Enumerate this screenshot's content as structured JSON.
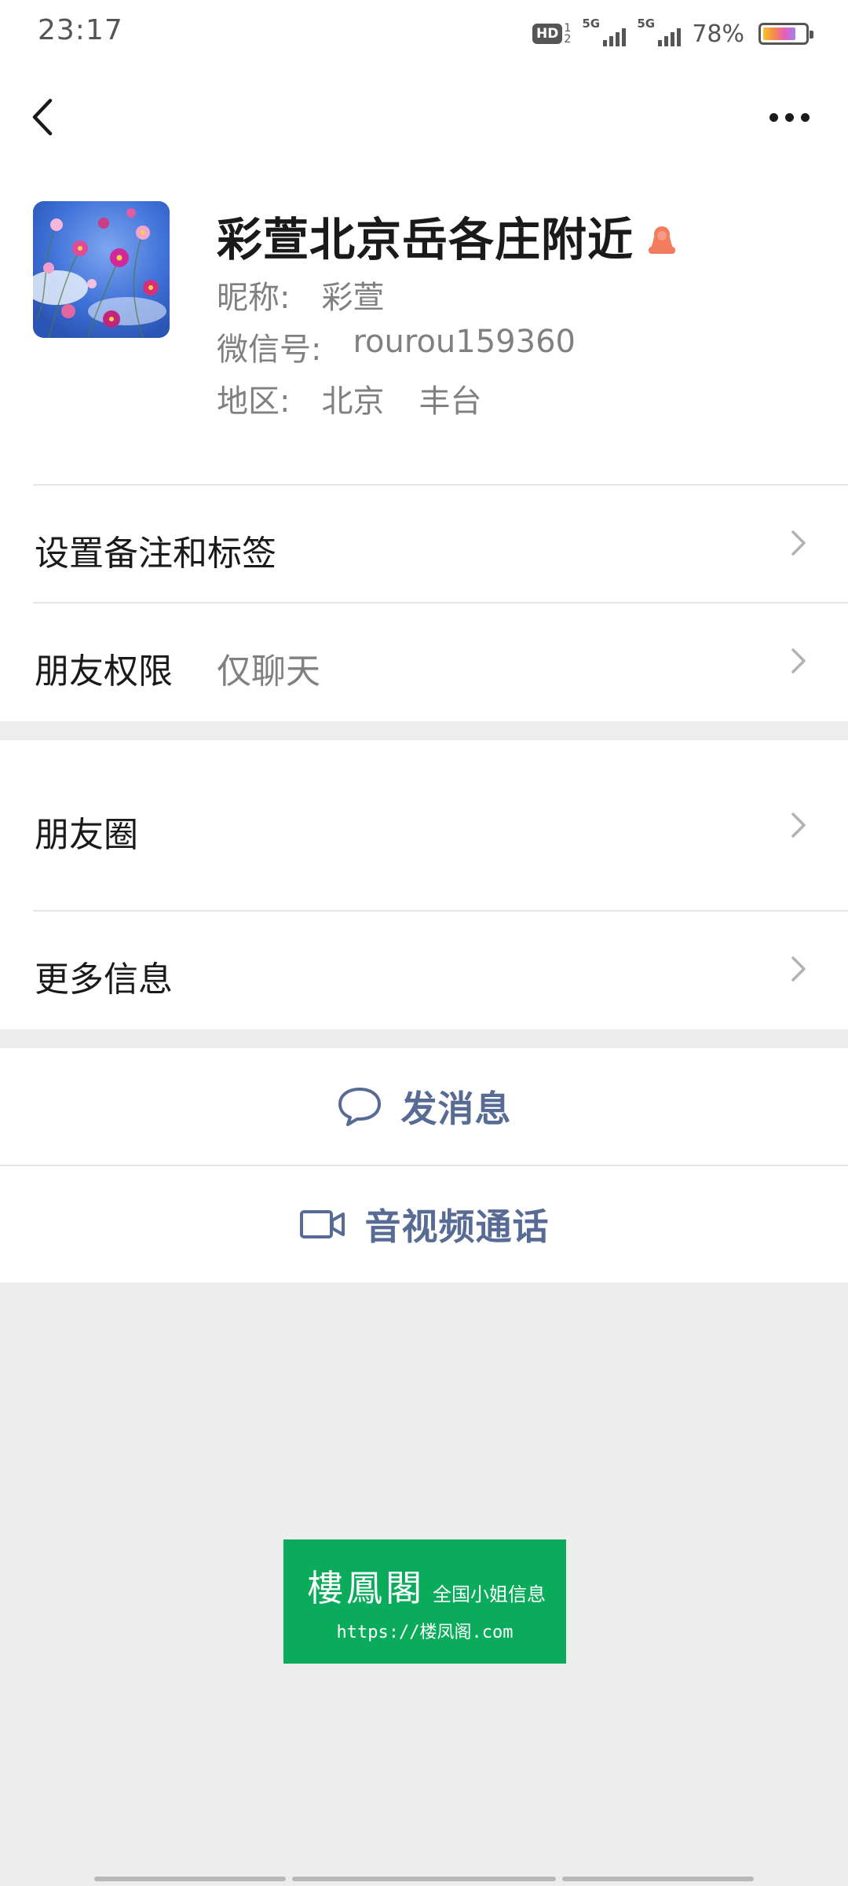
{
  "status_bar": {
    "time": "23:17",
    "hd_label": "HD",
    "hd_sub_top": "1",
    "hd_sub_bottom": "2",
    "sim1_label": "5G",
    "sim2_label": "5G",
    "battery_percent": "78%",
    "battery_level": 0.78
  },
  "nav": {
    "back_icon": "chevron-left-icon",
    "more_icon": "more-dots-icon"
  },
  "profile": {
    "name": "彩萱北京岳各庄附近",
    "gender_icon": "female-icon",
    "gender_color": "#f37b5e",
    "nickname_label": "昵称:",
    "nickname": "彩萱",
    "wechat_id_label": "微信号:",
    "wechat_id": "rourou159360",
    "region_label": "地区:",
    "region_city": "北京",
    "region_district": "丰台"
  },
  "rows": {
    "remark_label": "设置备注和标签",
    "permission_label": "朋友权限",
    "permission_value": "仅聊天",
    "moments_label": "朋友圈",
    "more_info_label": "更多信息"
  },
  "actions": {
    "send_message_label": "发消息",
    "call_label": "音视频通话",
    "accent_color": "#576b95"
  },
  "watermark": {
    "title": "樓鳳閣",
    "subtitle": "全国小姐信息",
    "url": "https://楼凤阁.com",
    "background": "#0aac5c"
  }
}
